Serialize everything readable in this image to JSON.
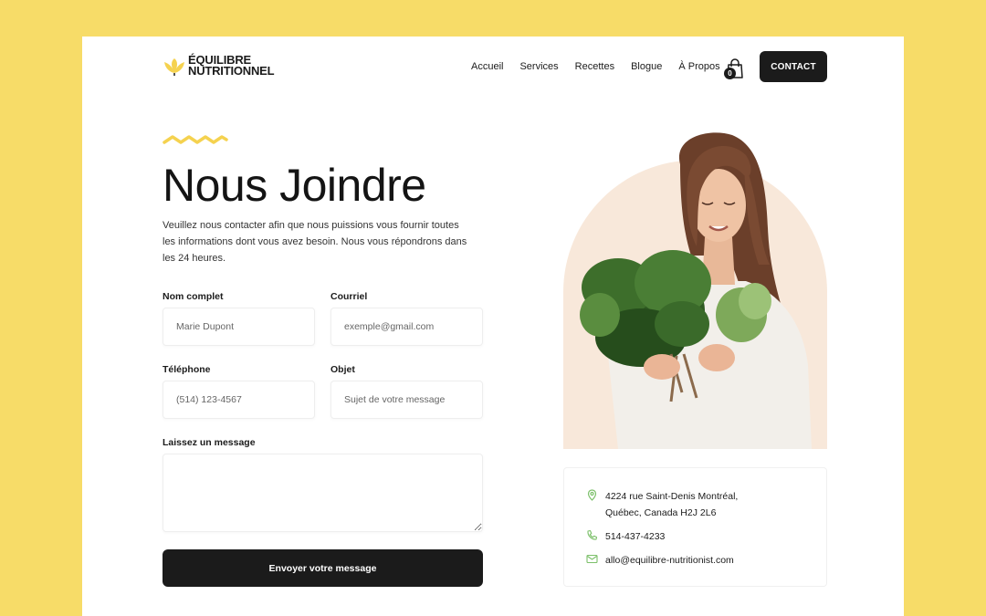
{
  "brand": {
    "line1": "ÉQUILIBRE",
    "line2": "NUTRITIONNEL",
    "accent": "#f5d24f"
  },
  "nav": {
    "items": [
      "Accueil",
      "Services",
      "Recettes",
      "Blogue",
      "À Propos"
    ],
    "cart_count": "0",
    "contact_label": "CONTACT"
  },
  "hero": {
    "title": "Nous Joindre",
    "intro": "Veuillez nous contacter afin que nous puissions vous fournir toutes les informations dont vous avez besoin. Nous vous répondrons dans les 24 heures."
  },
  "form": {
    "name_label": "Nom complet",
    "name_placeholder": "Marie Dupont",
    "email_label": "Courriel",
    "email_placeholder": "exemple@gmail.com",
    "phone_label": "Téléphone",
    "phone_placeholder": "(514) 123-4567",
    "subject_label": "Objet",
    "subject_placeholder": "Sujet de votre message",
    "message_label": "Laissez un message",
    "message_placeholder": "",
    "submit_label": "Envoyer votre message"
  },
  "contact_info": {
    "address_line1": "4224 rue Saint-Denis Montréal,",
    "address_line2": "Québec, Canada H2J 2L6",
    "phone": "514-437-4233",
    "email": "allo@equilibre-nutritionist.com",
    "icon_color": "#7cc06a"
  },
  "colors": {
    "background": "#f7dc68",
    "dark": "#1b1b1b",
    "arch": "#f8e8da"
  }
}
